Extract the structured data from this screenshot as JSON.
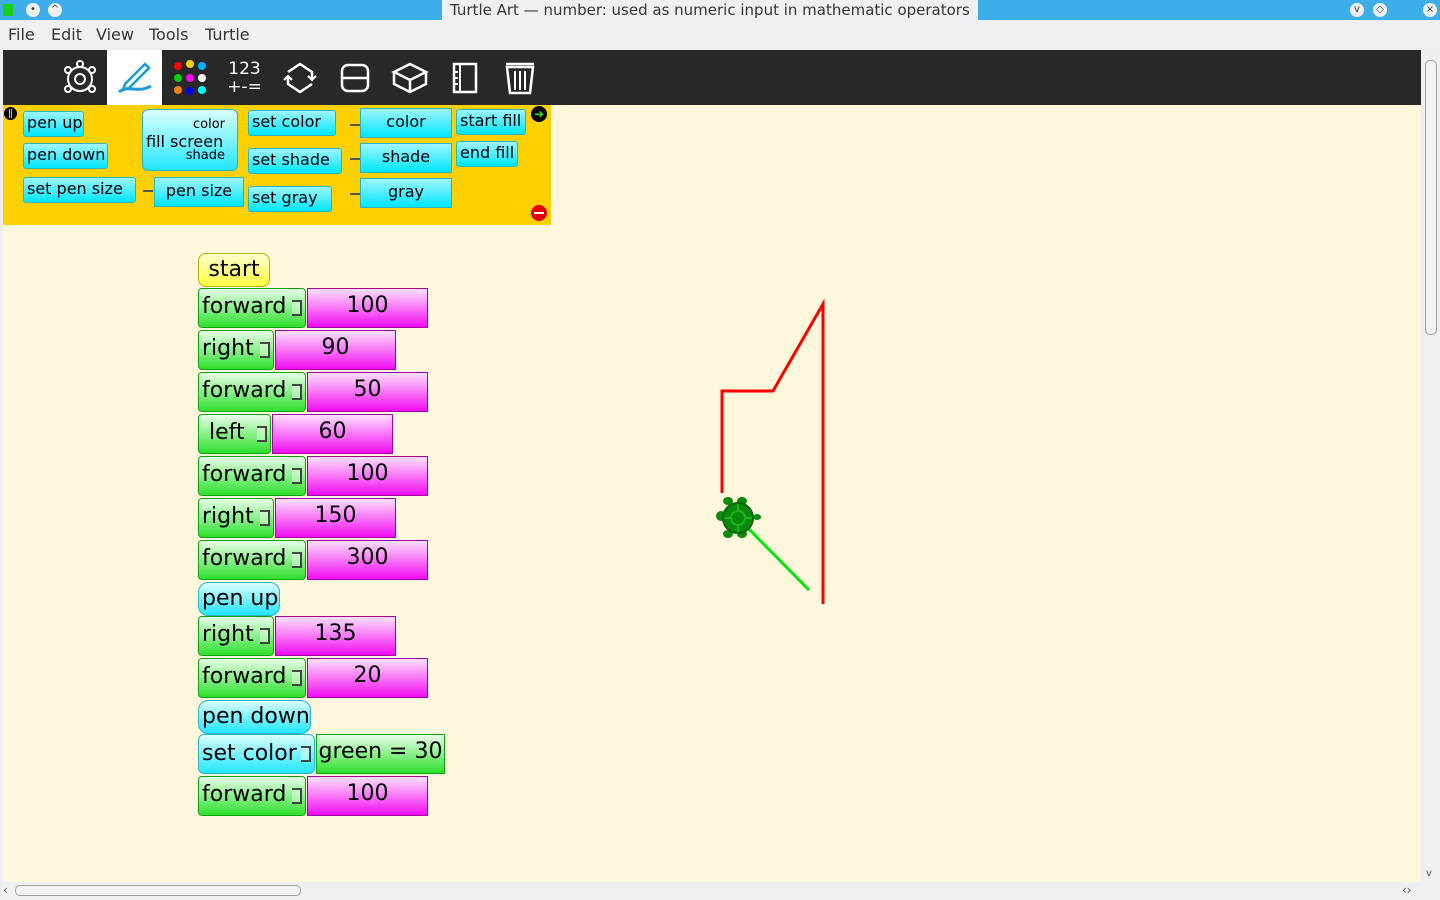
{
  "window": {
    "title": "Turtle Art — number: used as numeric input in mathematic operators"
  },
  "menubar": {
    "items": [
      "File",
      "Edit",
      "View",
      "Tools",
      "Turtle"
    ]
  },
  "toolbar": {
    "numbers_label_top": "123",
    "numbers_label_bottom": "+-="
  },
  "palette": {
    "pen_up": "pen up",
    "pen_down": "pen down",
    "set_pen_size": "set pen size",
    "pen_size": "pen size",
    "fill_screen": "fill screen",
    "fill_color": "color",
    "fill_shade": "shade",
    "set_color": "set color",
    "set_shade": "set shade",
    "set_gray": "set gray",
    "color": "color",
    "shade": "shade",
    "gray": "gray",
    "start_fill": "start fill",
    "end_fill": "end fill"
  },
  "program": {
    "start": "start",
    "blocks": [
      {
        "label": "forward",
        "value": "100"
      },
      {
        "label": "right",
        "value": "90"
      },
      {
        "label": "forward",
        "value": "50"
      },
      {
        "label": "left",
        "value": "60"
      },
      {
        "label": "forward",
        "value": "100"
      },
      {
        "label": "right",
        "value": "150"
      },
      {
        "label": "forward",
        "value": "300"
      },
      {
        "label": "pen up"
      },
      {
        "label": "right",
        "value": "135"
      },
      {
        "label": "forward",
        "value": "20"
      },
      {
        "label": "pen down"
      },
      {
        "label": "set color",
        "value": "green = 30"
      },
      {
        "label": "forward",
        "value": "100"
      }
    ]
  },
  "colors": {
    "accent": "#3daee9",
    "canvas": "#fff8dd",
    "palette": "#ffd000",
    "line_red": "#ff0000",
    "line_green": "#00e600",
    "turtle": "#0a8a0a"
  }
}
